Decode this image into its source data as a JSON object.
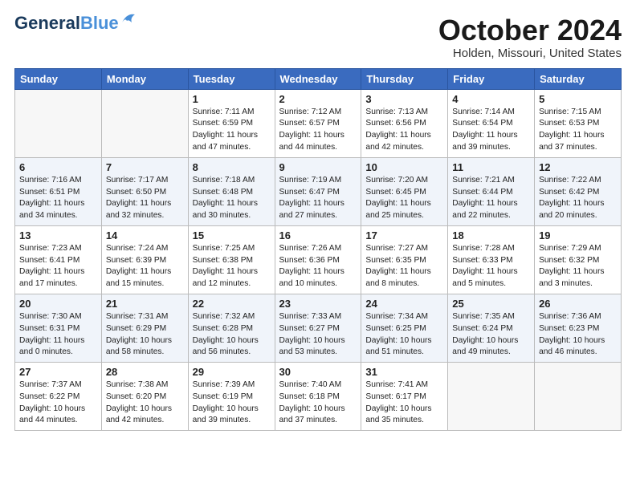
{
  "header": {
    "logo_line1": "General",
    "logo_line2": "Blue",
    "month": "October 2024",
    "location": "Holden, Missouri, United States"
  },
  "weekdays": [
    "Sunday",
    "Monday",
    "Tuesday",
    "Wednesday",
    "Thursday",
    "Friday",
    "Saturday"
  ],
  "weeks": [
    [
      {
        "day": "",
        "info": ""
      },
      {
        "day": "",
        "info": ""
      },
      {
        "day": "1",
        "info": "Sunrise: 7:11 AM\nSunset: 6:59 PM\nDaylight: 11 hours and 47 minutes."
      },
      {
        "day": "2",
        "info": "Sunrise: 7:12 AM\nSunset: 6:57 PM\nDaylight: 11 hours and 44 minutes."
      },
      {
        "day": "3",
        "info": "Sunrise: 7:13 AM\nSunset: 6:56 PM\nDaylight: 11 hours and 42 minutes."
      },
      {
        "day": "4",
        "info": "Sunrise: 7:14 AM\nSunset: 6:54 PM\nDaylight: 11 hours and 39 minutes."
      },
      {
        "day": "5",
        "info": "Sunrise: 7:15 AM\nSunset: 6:53 PM\nDaylight: 11 hours and 37 minutes."
      }
    ],
    [
      {
        "day": "6",
        "info": "Sunrise: 7:16 AM\nSunset: 6:51 PM\nDaylight: 11 hours and 34 minutes."
      },
      {
        "day": "7",
        "info": "Sunrise: 7:17 AM\nSunset: 6:50 PM\nDaylight: 11 hours and 32 minutes."
      },
      {
        "day": "8",
        "info": "Sunrise: 7:18 AM\nSunset: 6:48 PM\nDaylight: 11 hours and 30 minutes."
      },
      {
        "day": "9",
        "info": "Sunrise: 7:19 AM\nSunset: 6:47 PM\nDaylight: 11 hours and 27 minutes."
      },
      {
        "day": "10",
        "info": "Sunrise: 7:20 AM\nSunset: 6:45 PM\nDaylight: 11 hours and 25 minutes."
      },
      {
        "day": "11",
        "info": "Sunrise: 7:21 AM\nSunset: 6:44 PM\nDaylight: 11 hours and 22 minutes."
      },
      {
        "day": "12",
        "info": "Sunrise: 7:22 AM\nSunset: 6:42 PM\nDaylight: 11 hours and 20 minutes."
      }
    ],
    [
      {
        "day": "13",
        "info": "Sunrise: 7:23 AM\nSunset: 6:41 PM\nDaylight: 11 hours and 17 minutes."
      },
      {
        "day": "14",
        "info": "Sunrise: 7:24 AM\nSunset: 6:39 PM\nDaylight: 11 hours and 15 minutes."
      },
      {
        "day": "15",
        "info": "Sunrise: 7:25 AM\nSunset: 6:38 PM\nDaylight: 11 hours and 12 minutes."
      },
      {
        "day": "16",
        "info": "Sunrise: 7:26 AM\nSunset: 6:36 PM\nDaylight: 11 hours and 10 minutes."
      },
      {
        "day": "17",
        "info": "Sunrise: 7:27 AM\nSunset: 6:35 PM\nDaylight: 11 hours and 8 minutes."
      },
      {
        "day": "18",
        "info": "Sunrise: 7:28 AM\nSunset: 6:33 PM\nDaylight: 11 hours and 5 minutes."
      },
      {
        "day": "19",
        "info": "Sunrise: 7:29 AM\nSunset: 6:32 PM\nDaylight: 11 hours and 3 minutes."
      }
    ],
    [
      {
        "day": "20",
        "info": "Sunrise: 7:30 AM\nSunset: 6:31 PM\nDaylight: 11 hours and 0 minutes."
      },
      {
        "day": "21",
        "info": "Sunrise: 7:31 AM\nSunset: 6:29 PM\nDaylight: 10 hours and 58 minutes."
      },
      {
        "day": "22",
        "info": "Sunrise: 7:32 AM\nSunset: 6:28 PM\nDaylight: 10 hours and 56 minutes."
      },
      {
        "day": "23",
        "info": "Sunrise: 7:33 AM\nSunset: 6:27 PM\nDaylight: 10 hours and 53 minutes."
      },
      {
        "day": "24",
        "info": "Sunrise: 7:34 AM\nSunset: 6:25 PM\nDaylight: 10 hours and 51 minutes."
      },
      {
        "day": "25",
        "info": "Sunrise: 7:35 AM\nSunset: 6:24 PM\nDaylight: 10 hours and 49 minutes."
      },
      {
        "day": "26",
        "info": "Sunrise: 7:36 AM\nSunset: 6:23 PM\nDaylight: 10 hours and 46 minutes."
      }
    ],
    [
      {
        "day": "27",
        "info": "Sunrise: 7:37 AM\nSunset: 6:22 PM\nDaylight: 10 hours and 44 minutes."
      },
      {
        "day": "28",
        "info": "Sunrise: 7:38 AM\nSunset: 6:20 PM\nDaylight: 10 hours and 42 minutes."
      },
      {
        "day": "29",
        "info": "Sunrise: 7:39 AM\nSunset: 6:19 PM\nDaylight: 10 hours and 39 minutes."
      },
      {
        "day": "30",
        "info": "Sunrise: 7:40 AM\nSunset: 6:18 PM\nDaylight: 10 hours and 37 minutes."
      },
      {
        "day": "31",
        "info": "Sunrise: 7:41 AM\nSunset: 6:17 PM\nDaylight: 10 hours and 35 minutes."
      },
      {
        "day": "",
        "info": ""
      },
      {
        "day": "",
        "info": ""
      }
    ]
  ]
}
